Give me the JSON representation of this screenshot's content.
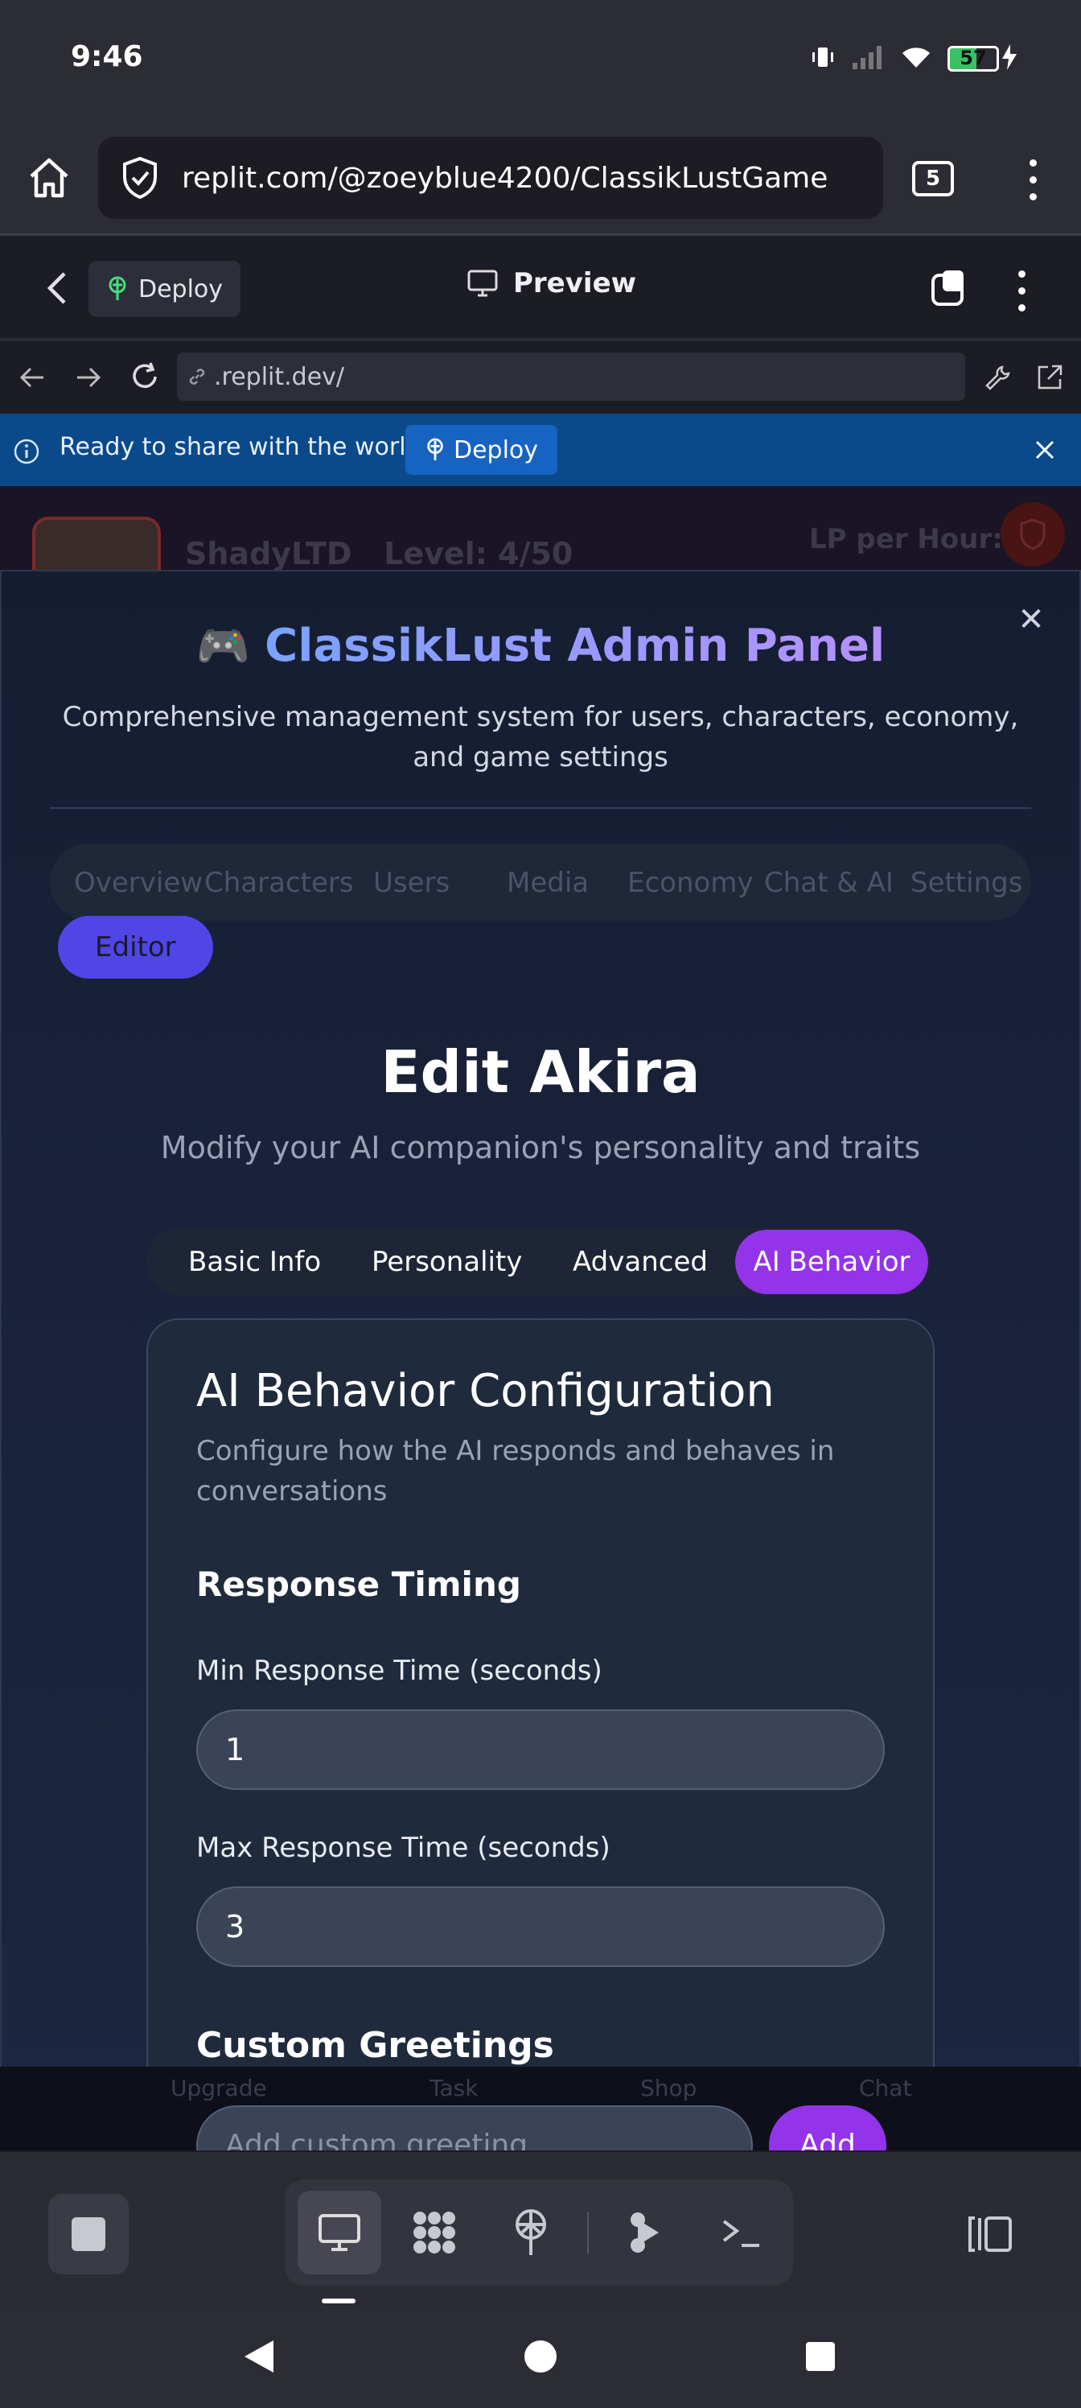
{
  "status_bar": {
    "time": "9:46",
    "battery": "57",
    "battery_fraction": 0.57
  },
  "browser": {
    "url": "replit.com/@zoeyblue4200/ClassikLustGame",
    "tab_count": "5"
  },
  "replit_header": {
    "deploy_label": "Deploy",
    "preview_label": "Preview"
  },
  "preview_nav": {
    "url": ".replit.dev/"
  },
  "banner": {
    "text": "Ready to share with the world?",
    "button": "Deploy"
  },
  "game": {
    "player": "ShadyLTD",
    "level": "Level: 4/50",
    "lp_label": "LP per Hour:",
    "bottom_nav": [
      "Upgrade",
      "Task",
      "Shop",
      "Chat"
    ]
  },
  "admin_panel": {
    "icon": "🎮",
    "title": "ClassikLust Admin Panel",
    "subtitle": "Comprehensive management system for users, characters, economy, and game settings",
    "tabs": [
      "Overview",
      "Characters",
      "Users",
      "Media",
      "Economy",
      "Chat & AI",
      "Settings"
    ],
    "active_tab": "Editor"
  },
  "editor": {
    "title": "Edit Akira",
    "subtitle": "Modify your AI companion's personality and traits",
    "tabs": [
      "Basic Info",
      "Personality",
      "Advanced",
      "AI Behavior"
    ],
    "card": {
      "title": "AI Behavior Configuration",
      "description": "Configure how the AI responds and behaves in conversations",
      "section_timing": "Response Timing",
      "min_label": "Min Response Time (seconds)",
      "min_value": "1",
      "max_label": "Max Response Time (seconds)",
      "max_value": "3",
      "section_greetings": "Custom Greetings",
      "greeting_placeholder": "Add custom greeting...",
      "add_button": "Add"
    }
  },
  "colors": {
    "accent_indigo": "#4f46e5",
    "accent_purple": "#9333ea",
    "banner_blue": "#0b4a8a",
    "deploy_green": "#4ade80"
  }
}
